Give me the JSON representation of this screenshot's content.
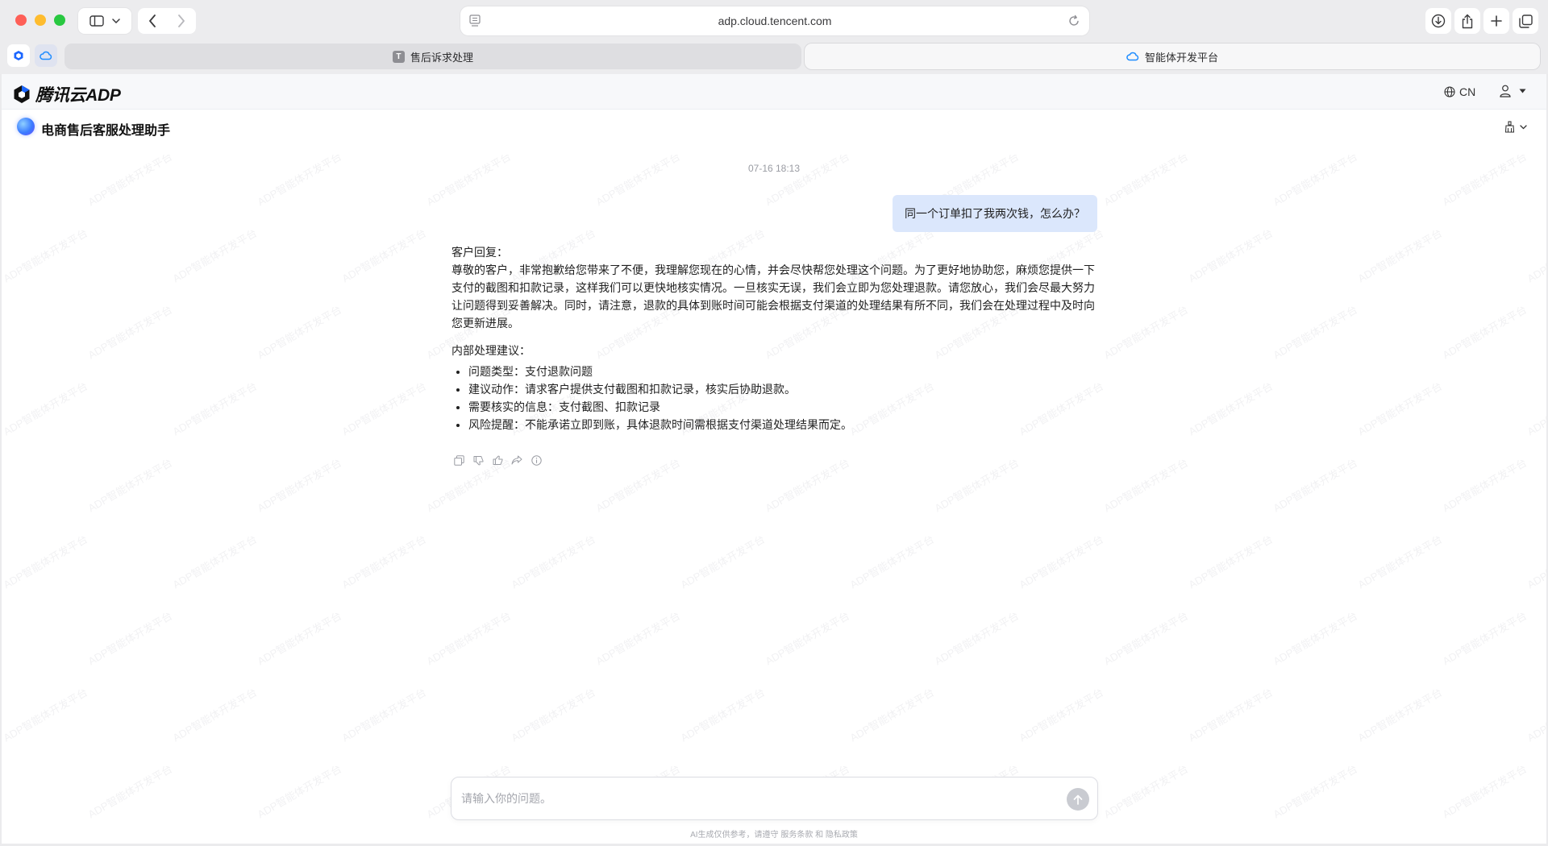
{
  "browser": {
    "url": "adp.cloud.tencent.com",
    "tabs": [
      {
        "label": "售后诉求处理",
        "favicon": "T"
      },
      {
        "label": "智能体开发平台"
      }
    ]
  },
  "topnav": {
    "brand": "腾讯云ADP",
    "language": "CN"
  },
  "app": {
    "title": "电商售后客服处理助手"
  },
  "watermark": "ADP智能体开发平台",
  "chat": {
    "timestamp": "07-16 18:13",
    "user_message": "同一个订单扣了我两次钱，怎么办？",
    "bot": {
      "reply_heading": "客户回复：",
      "reply_body": "尊敬的客户，非常抱歉给您带来了不便，我理解您现在的心情，并会尽快帮您处理这个问题。为了更好地协助您，麻烦您提供一下支付的截图和扣款记录，这样我们可以更快地核实情况。一旦核实无误，我们会立即为您处理退款。请您放心，我们会尽最大努力让问题得到妥善解决。同时，请注意，退款的具体到账时间可能会根据支付渠道的处理结果有所不同，我们会在处理过程中及时向您更新进展。",
      "internal_heading": "内部处理建议：",
      "bullets": [
        "问题类型：支付退款问题",
        "建议动作：请求客户提供支付截图和扣款记录，核实后协助退款。",
        "需要核实的信息：支付截图、扣款记录",
        "风险提醒：不能承诺立即到账，具体退款时间需根据支付渠道处理结果而定。"
      ]
    }
  },
  "input": {
    "placeholder": "请输入你的问题。"
  },
  "footer": {
    "disclaimer": "AI生成仅供参考，请遵守 服务条款 和 隐私政策"
  }
}
